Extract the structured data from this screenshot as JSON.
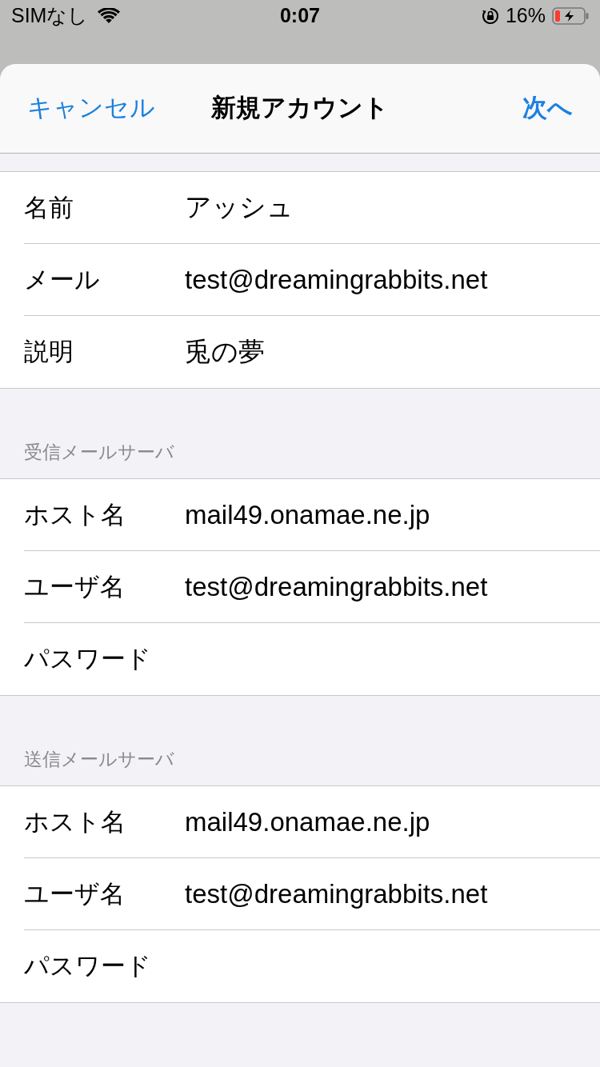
{
  "status_bar": {
    "carrier": "SIMなし",
    "time": "0:07",
    "battery_percent": "16%"
  },
  "nav_bar": {
    "cancel": "キャンセル",
    "title": "新規アカウント",
    "next": "次へ"
  },
  "sections": [
    {
      "rows": [
        {
          "label": "名前",
          "value": "アッシュ"
        },
        {
          "label": "メール",
          "value": "test@dreamingrabbits.net"
        },
        {
          "label": "説明",
          "value": "兎の夢"
        }
      ]
    },
    {
      "header": "受信メールサーバ",
      "rows": [
        {
          "label": "ホスト名",
          "value": "mail49.onamae.ne.jp"
        },
        {
          "label": "ユーザ名",
          "value": "test@dreamingrabbits.net"
        },
        {
          "label": "パスワード"
        }
      ]
    },
    {
      "header": "送信メールサーバ",
      "rows": [
        {
          "label": "ホスト名",
          "value": "mail49.onamae.ne.jp"
        },
        {
          "label": "ユーザ名",
          "value": "test@dreamingrabbits.net"
        },
        {
          "label": "パスワード"
        }
      ]
    }
  ]
}
